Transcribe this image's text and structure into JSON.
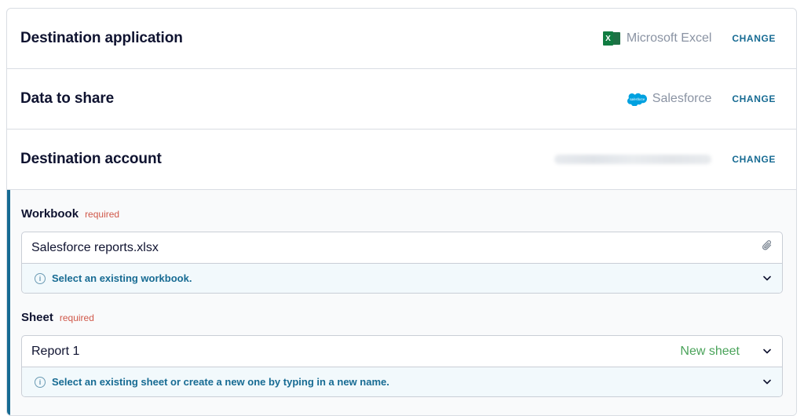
{
  "rows": [
    {
      "title": "Destination application",
      "value": "Microsoft Excel",
      "icon": "excel-icon",
      "action": "CHANGE"
    },
    {
      "title": "Data to share",
      "value": "Salesforce",
      "icon": "salesforce-icon",
      "icon_text": "salesforce",
      "action": "CHANGE"
    },
    {
      "title": "Destination account",
      "value": "",
      "action": "CHANGE"
    }
  ],
  "workbook": {
    "label": "Workbook",
    "required": "required",
    "value": "Salesforce reports.xlsx",
    "help": "Select an existing workbook."
  },
  "sheet": {
    "label": "Sheet",
    "required": "required",
    "value": "Report 1",
    "badge": "New sheet",
    "help": "Select an existing sheet or create a new one by typing in a new name."
  },
  "colors": {
    "accent": "#176b93",
    "required": "#d0584a",
    "new_sheet": "#4aa35a",
    "excel": "#107c41",
    "salesforce": "#00a1e0"
  }
}
